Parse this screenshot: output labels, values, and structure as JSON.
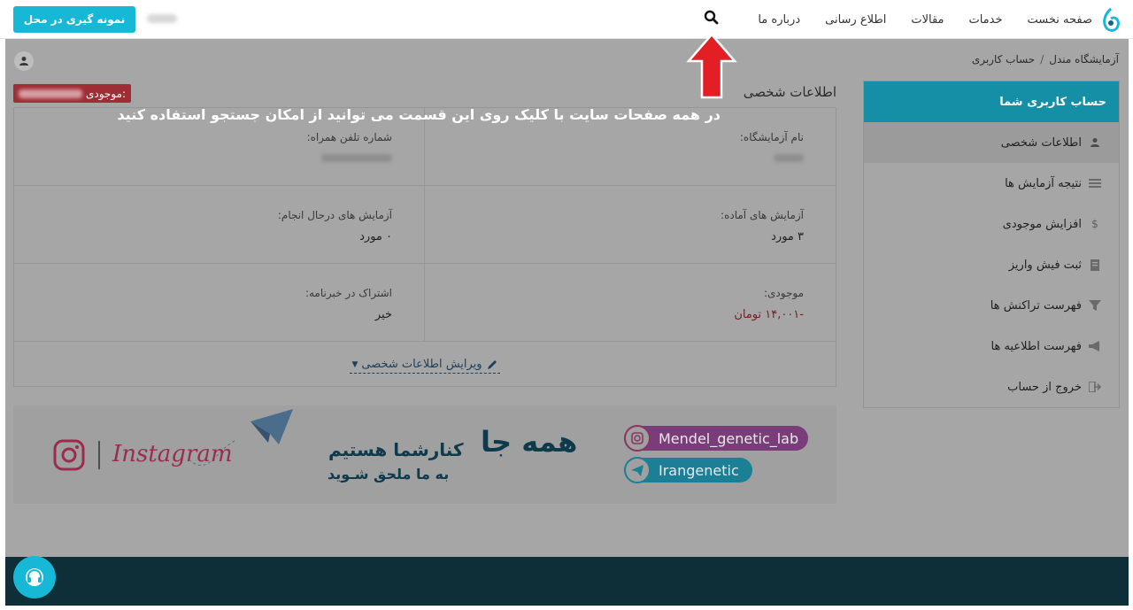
{
  "navbar": {
    "logo_icon": "lab-logo-icon",
    "menu": [
      "صفحه نخست",
      "خدمات",
      "مقالات",
      "اطلاع رسانی",
      "درباره ما"
    ],
    "search_icon": "search-icon",
    "cta_label": "نمونه گیری در محل"
  },
  "breadcrumb": {
    "home": "آزمایشگاه مندل",
    "separator": "/",
    "current": "حساب کاربری"
  },
  "sidebar": {
    "title": "حساب کاربری شما",
    "items": [
      {
        "label": "اطلاعات شخصی",
        "icon": "user-icon",
        "active": true
      },
      {
        "label": "نتیجه آزمایش ها",
        "icon": "list-icon"
      },
      {
        "label": "افزایش موجودی",
        "icon": "dollar-icon"
      },
      {
        "label": "ثبت فیش واریز",
        "icon": "receipt-icon"
      },
      {
        "label": "فهرست تراکنش ها",
        "icon": "filter-icon"
      },
      {
        "label": "فهرست اطلاعیه ها",
        "icon": "megaphone-icon"
      },
      {
        "label": "خروج از حساب",
        "icon": "logout-icon"
      }
    ]
  },
  "main": {
    "section_title": "اطلاعات شخصی",
    "balance_badge_label": "موجودی:",
    "rows": [
      {
        "right": {
          "label": "نام آزمایشگاه:",
          "value": ""
        },
        "left": {
          "label": "شماره تلفن همراه:",
          "value": ""
        }
      },
      {
        "right": {
          "label": "آزمایش های آماده:",
          "value": "۳ مورد"
        },
        "left": {
          "label": "آزمایش های درحال انجام:",
          "value": "۰ مورد"
        }
      },
      {
        "right": {
          "label": "موجودی:",
          "value": "-۱۴,۰۰۱ تومان"
        },
        "left": {
          "label": "اشتراک در خبرنامه:",
          "value": "خیر"
        }
      }
    ],
    "edit_link": "ویرایش اطلاعات شخصی"
  },
  "annotation": {
    "text": "در همه صفحات سایت با کلیک روی این قسمت می توانید از امکان جستجو استفاده کنید",
    "color": "#e31e24"
  },
  "banner": {
    "headline": "همه جا",
    "line1": "کنارشما هستیم",
    "line2": "به ما ملحق شـوید",
    "instagram_handle": "Mendel_genetic_lab",
    "telegram_handle": "Irangenetic",
    "instagram_word": "Instagram"
  },
  "colors": {
    "accent": "#17b8d6",
    "sidebar_head": "#158fa5",
    "footer": "#0f2f38",
    "negative": "#9f2d35"
  }
}
